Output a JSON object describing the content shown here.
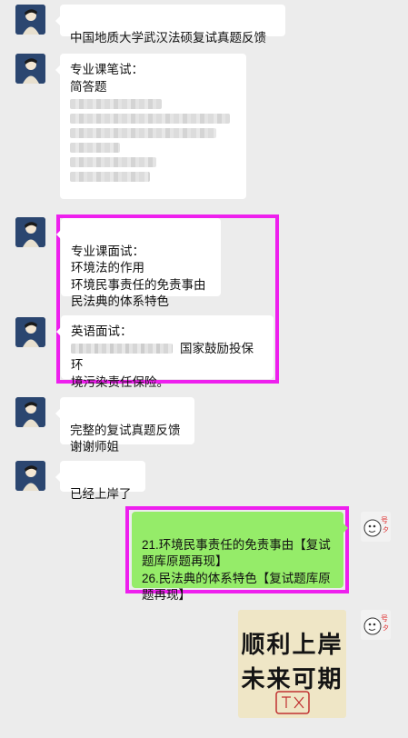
{
  "messages": [
    {
      "id": "m1",
      "side": "left",
      "text": "中国地质大学武汉法硕复试真题反馈"
    },
    {
      "id": "m2",
      "side": "left",
      "title": "专业课笔试：",
      "subtitle": "简答题"
    },
    {
      "id": "m3",
      "side": "left",
      "text": "专业课面试：\n环境法的作用\n环境民事责任的免责事由\n民法典的体系特色"
    },
    {
      "id": "m4",
      "side": "left",
      "title": "英语面试：",
      "text_after_blur": "国家鼓励投保环",
      "line2": "境污染责任保险。"
    },
    {
      "id": "m5",
      "side": "left",
      "text": "完整的复试真题反馈\n谢谢师姐"
    },
    {
      "id": "m6",
      "side": "left",
      "text": "已经上岸了"
    },
    {
      "id": "m7",
      "side": "right",
      "text": "21.环境民事责任的免责事由【复试\n题库原题再现】\n26.民法典的体系特色【复试题库原\n题再现】"
    },
    {
      "id": "m8",
      "side": "right",
      "type": "image",
      "line1": "顺利上岸",
      "line2": "未来可期"
    }
  ],
  "colors": {
    "background": "#ececec",
    "bubble_left": "#ffffff",
    "bubble_right": "#95ec69",
    "highlight": "#ee1fee"
  }
}
